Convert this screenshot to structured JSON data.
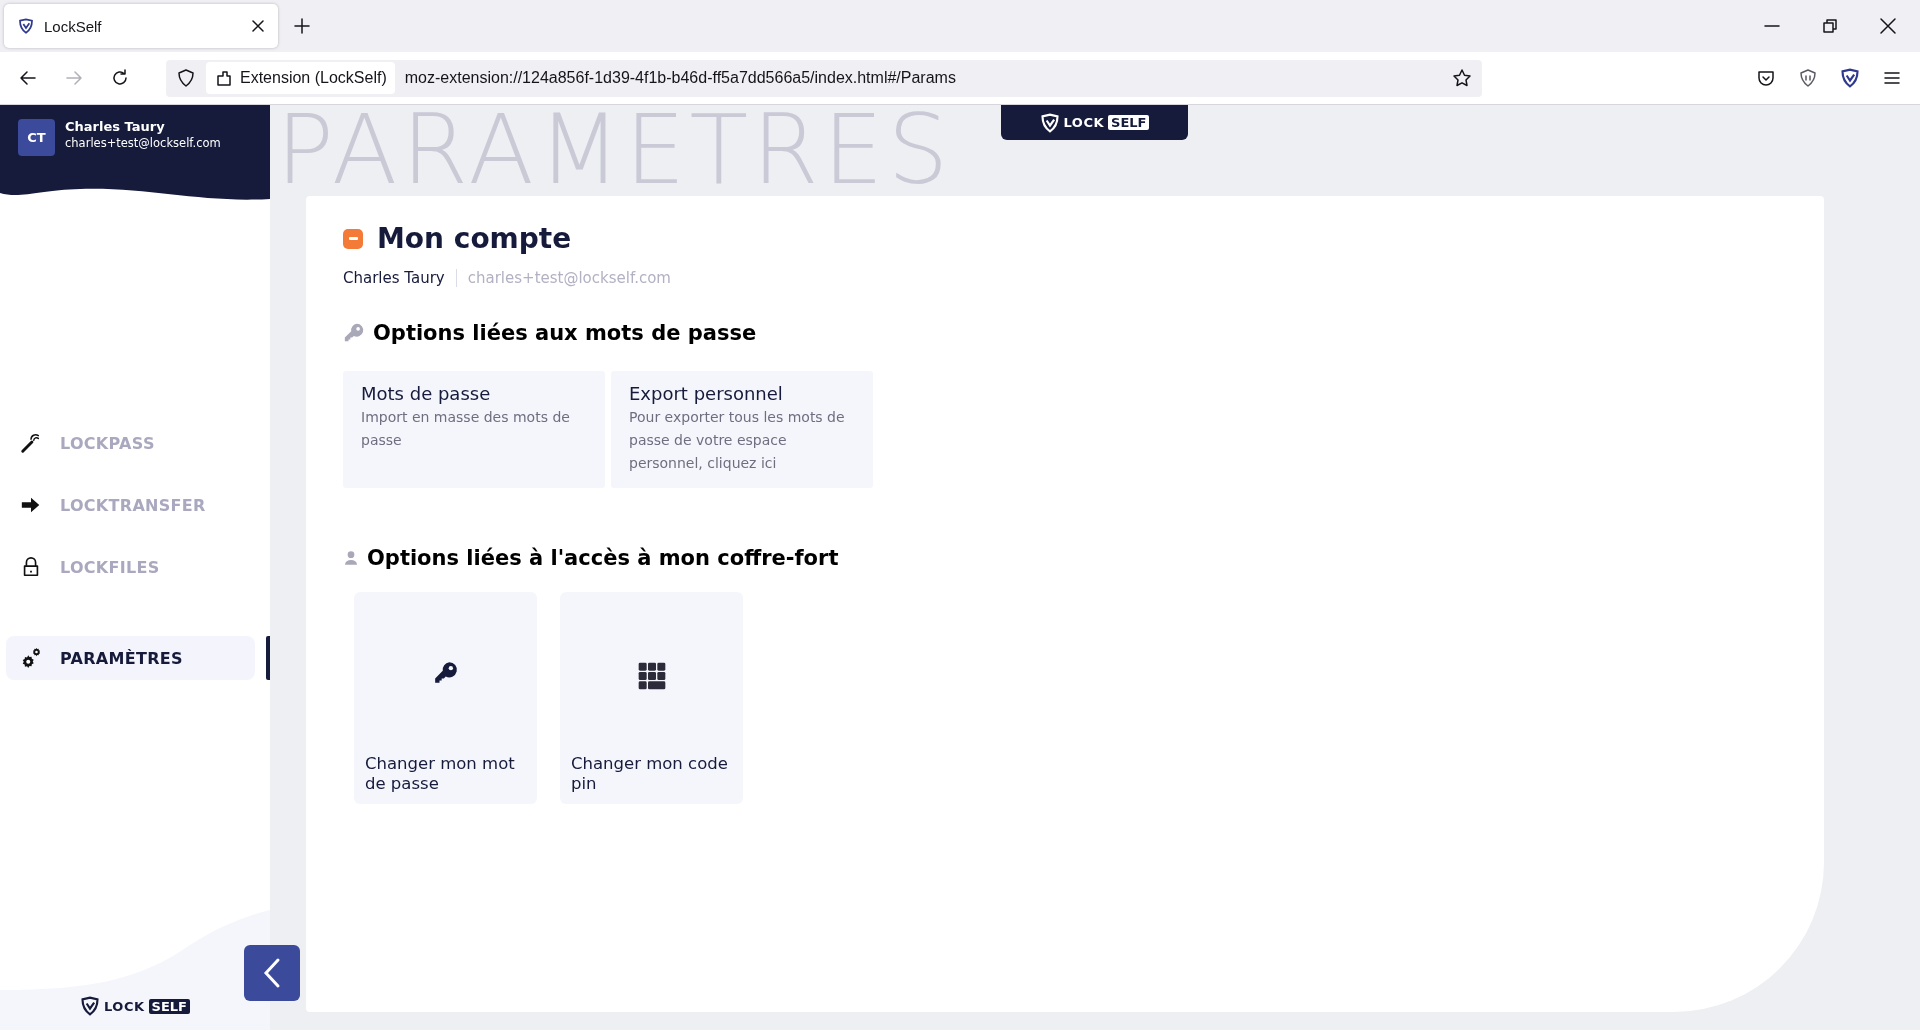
{
  "browser": {
    "tab_title": "LockSelf",
    "identity": "Extension (LockSelf)",
    "url": "moz-extension://124a856f-1d39-4f1b-b46d-ff5a7dd566a5/index.html#/Params"
  },
  "user": {
    "initials": "CT",
    "name": "Charles Taury",
    "email": "charles+test@lockself.com"
  },
  "nav_groups": [
    {
      "items": [
        {
          "label": "LOCKPASS",
          "selected": false
        },
        {
          "label": "LOCKTRANSFER",
          "selected": false
        },
        {
          "label": "LOCKFILES",
          "selected": false
        }
      ]
    },
    {
      "items": [
        {
          "label": "PARAMÈTRES",
          "selected": true
        }
      ]
    }
  ],
  "footer_logo": {
    "lock": "LOCK",
    "self": "SELF"
  },
  "header_logo": {
    "lock": "LOCK",
    "self": "SELF"
  },
  "watermark": "PARAMETRES",
  "page": {
    "title": "Mon compte",
    "name": "Charles Taury",
    "email": "charles+test@lockself.com",
    "sections": [
      {
        "title": "Options liées aux mots de passe",
        "kind": "cards",
        "items": [
          {
            "title": "Mots de passe",
            "description": "Import en masse des mots de passe"
          },
          {
            "title": "Export personnel",
            "description": "Pour exporter tous les mots de passe de votre espace personnel, cliquez ici"
          }
        ]
      },
      {
        "title": "Options liées à l'accès à mon coffre-fort",
        "kind": "tiles",
        "items": [
          {
            "label": "Changer mon mot de passe"
          },
          {
            "label": "Changer mon code pin"
          }
        ]
      }
    ]
  }
}
